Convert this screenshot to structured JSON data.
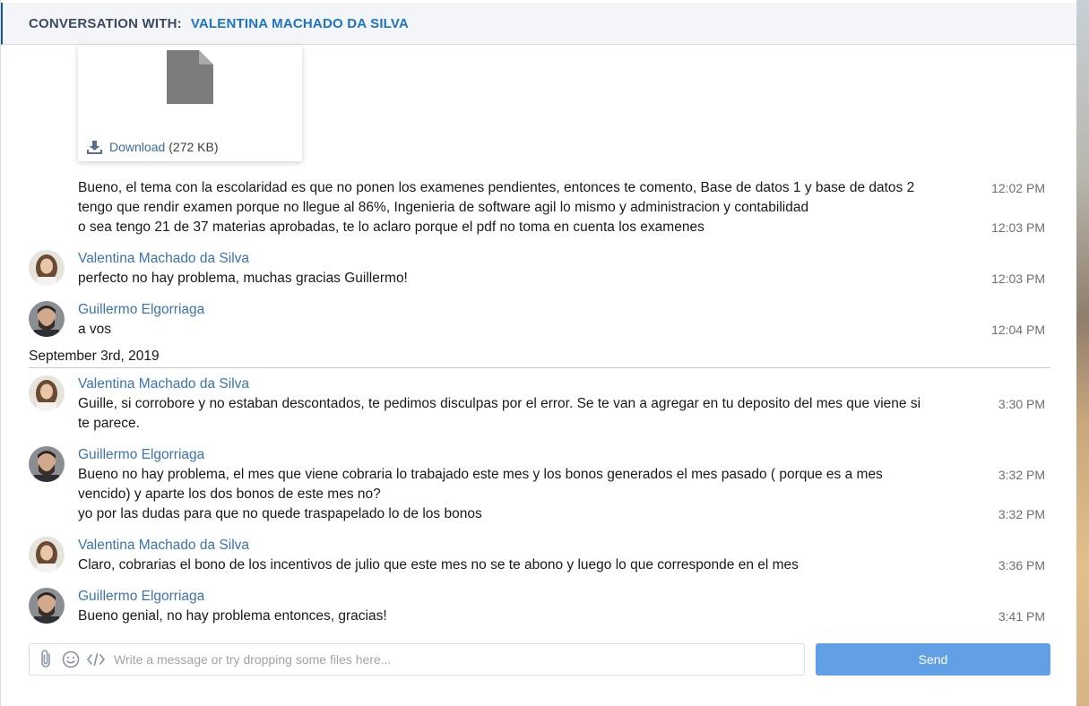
{
  "header": {
    "prefix": "CONVERSATION WITH:",
    "name": "VALENTINA MACHADO DA SILVA"
  },
  "attachment": {
    "icon": "file-icon",
    "download_label": "Download",
    "size": "(272 KB)"
  },
  "messages": [
    {
      "text": "Bueno, el tema con la escolaridad es que no ponen los examenes pendientes, entonces te comento, Base de datos 1 y base de datos 2",
      "time": "12:02 PM"
    },
    {
      "text": "tengo que rendir examen porque no llegue al 86%, Ingenieria de software agil lo mismo y administracion y contabilidad"
    },
    {
      "text": "o sea tengo 21 de 37 materias aprobadas, te lo aclaro porque el pdf no toma en cuenta los examenes",
      "time": "12:03 PM"
    },
    {
      "sender": "Valentina Machado da Silva",
      "text": "perfecto no hay problema, muchas gracias Guillermo!",
      "time": "12:03 PM"
    },
    {
      "sender": "Guillermo Elgorriaga",
      "text": "a vos",
      "time": "12:04 PM"
    },
    {
      "sender": "Valentina Machado da Silva",
      "text1": "Guille, si corrobore y no estaban descontados, te pedimos disculpas por el error. Se te van a agregar en tu deposito del mes que viene si",
      "text2": "te parece.",
      "time": "3:30 PM"
    },
    {
      "sender": "Guillermo Elgorriaga",
      "text1": "Bueno no hay problema, el mes que viene cobraria lo trabajado este mes y los bonos generados el mes pasado ( porque es a mes",
      "text2": "vencido) y aparte los dos bonos de este mes no?",
      "time": "3:32 PM"
    },
    {
      "text": "yo por las dudas para que no quede traspapelado lo de los bonos",
      "time": "3:32 PM"
    },
    {
      "sender": "Valentina Machado da Silva",
      "text": "Claro, cobrarias el bono de los incentivos de julio que este mes no se te abono y luego lo que corresponde en el mes",
      "time": "3:36 PM"
    },
    {
      "sender": "Guillermo Elgorriaga",
      "text": "Bueno genial, no hay problema entonces, gracias!",
      "time": "3:41 PM"
    }
  ],
  "date_divider": "September 3rd, 2019",
  "composer": {
    "placeholder": "Write a message or try dropping some files here...",
    "value": "",
    "send_label": "Send",
    "icons": [
      "paperclip-icon",
      "emoji-icon",
      "code-icon"
    ]
  },
  "colors": {
    "sender": "#3b73b0",
    "send_button": "#62a0e6",
    "header_bg": "#f3f5f9"
  }
}
